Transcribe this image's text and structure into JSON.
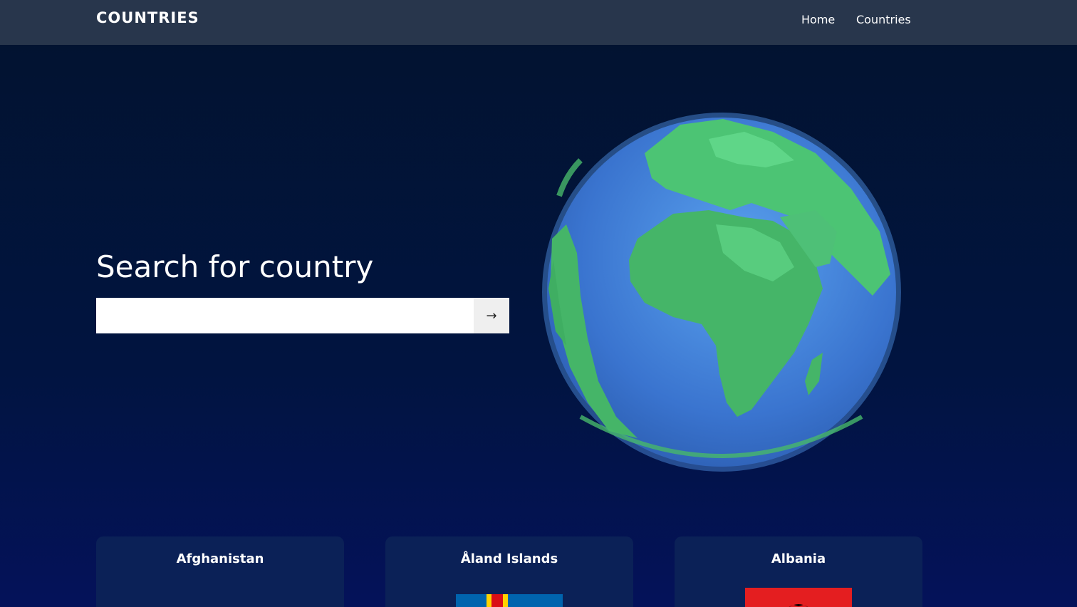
{
  "navbar": {
    "brand": "COUNTRIES",
    "links": [
      {
        "label": "Home"
      },
      {
        "label": "Countries"
      }
    ]
  },
  "hero": {
    "title": "Search for country",
    "search": {
      "value": "",
      "placeholder": "",
      "button_label": "→"
    },
    "globe_icon": "globe-icon"
  },
  "countries": [
    {
      "name": "Afghanistan",
      "flag": ""
    },
    {
      "name": "Åland Islands",
      "flag": "aland-flag-icon"
    },
    {
      "name": "Albania",
      "flag": "albania-flag-icon"
    }
  ],
  "colors": {
    "navbar_bg": "#28364c",
    "page_bg": "#011440",
    "card_bg": "#0b2157",
    "globe_ocean": "#3d7fd8",
    "globe_land": "#47b86a"
  }
}
